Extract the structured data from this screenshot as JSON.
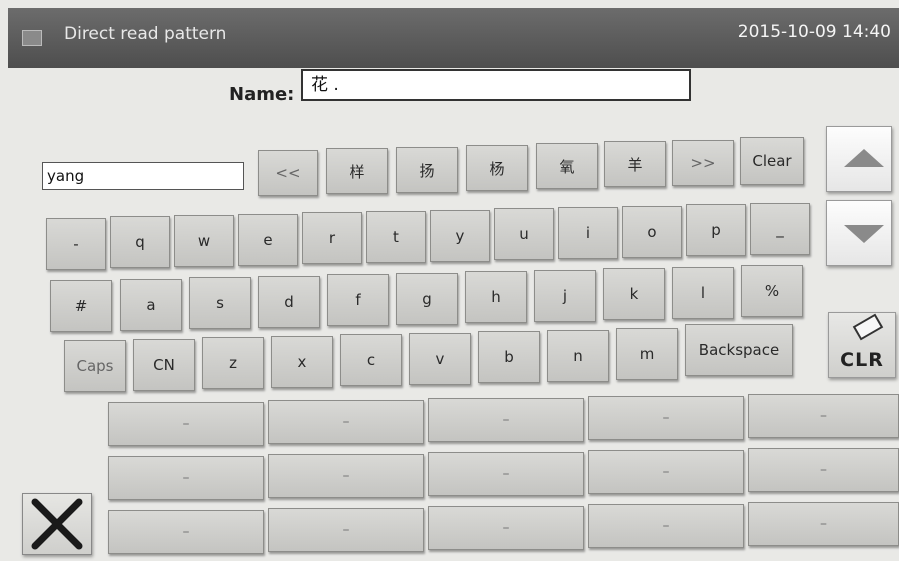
{
  "header": {
    "title": "Direct read pattern",
    "datetime": "2015-10-09 14:40"
  },
  "name_field": {
    "label": "Name:",
    "value": "花 ."
  },
  "pinyin_field": {
    "value": "yang"
  },
  "candidates": {
    "prev": "<<",
    "items": [
      "样",
      "扬",
      "杨",
      "氧",
      "羊"
    ],
    "next": ">>",
    "clear": "Clear"
  },
  "keyboard": {
    "row1": [
      "-",
      "q",
      "w",
      "e",
      "r",
      "t",
      "y",
      "u",
      "i",
      "o",
      "p",
      "_"
    ],
    "row2": [
      "#",
      "a",
      "s",
      "d",
      "f",
      "g",
      "h",
      "j",
      "k",
      "l",
      "%"
    ],
    "caps": "Caps",
    "cn": "CN",
    "row3": [
      "z",
      "x",
      "c",
      "v",
      "b",
      "n",
      "m"
    ],
    "backspace": "Backspace"
  },
  "history_slots": [
    [
      "–",
      "–",
      "–",
      "–",
      "–"
    ],
    [
      "–",
      "–",
      "–",
      "–",
      "–"
    ],
    [
      "–",
      "–",
      "–",
      "–",
      "–"
    ]
  ],
  "side_buttons": {
    "page_up_icon": "up-triangle",
    "page_down_icon": "down-triangle",
    "clr_label": "CLR",
    "clr_icon": "eraser",
    "close_icon": "x-mark"
  }
}
